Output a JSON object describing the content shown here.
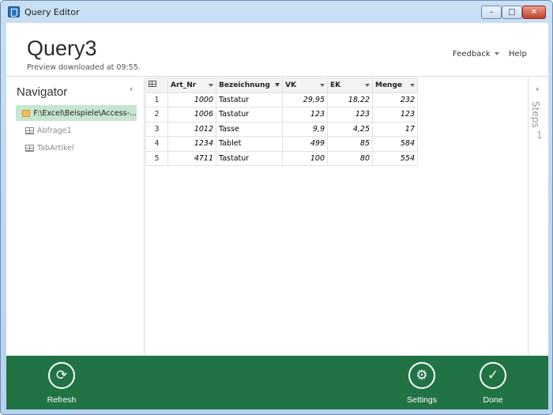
{
  "window": {
    "title": "Query Editor",
    "minimize_glyph": "–",
    "maximize_glyph": "□",
    "close_glyph": "✕"
  },
  "header": {
    "query_title": "Query3",
    "preview_text": "Preview downloaded at 09:55.",
    "feedback_label": "Feedback",
    "help_label": "Help"
  },
  "navigator": {
    "title": "Navigator",
    "collapse_glyph": "‹",
    "items": [
      {
        "label": "F:\\Excel\\Beispiele\\Access-...",
        "icon": "folder-icon",
        "selected": true
      },
      {
        "label": "Abfrage1",
        "icon": "table-icon",
        "selected": false
      },
      {
        "label": "TabArtikel",
        "icon": "table-icon",
        "selected": false
      }
    ]
  },
  "grid": {
    "columns": [
      "Art_Nr",
      "Bezeichnung",
      "VK",
      "EK",
      "Menge"
    ],
    "rows": [
      {
        "idx": "1",
        "Art_Nr": "1000",
        "Bezeichnung": "Tastatur",
        "VK": "29,95",
        "EK": "18,22",
        "Menge": "232"
      },
      {
        "idx": "2",
        "Art_Nr": "1006",
        "Bezeichnung": "Tastatur",
        "VK": "123",
        "EK": "123",
        "Menge": "123"
      },
      {
        "idx": "3",
        "Art_Nr": "1012",
        "Bezeichnung": "Tasse",
        "VK": "9,9",
        "EK": "4,25",
        "Menge": "17"
      },
      {
        "idx": "4",
        "Art_Nr": "1234",
        "Bezeichnung": "Tablet",
        "VK": "499",
        "EK": "85",
        "Menge": "584"
      },
      {
        "idx": "5",
        "Art_Nr": "4711",
        "Bezeichnung": "Tastatur",
        "VK": "100",
        "EK": "80",
        "Menge": "554"
      }
    ]
  },
  "steps": {
    "collapse_glyph": "‹",
    "label": "Steps",
    "count": "1"
  },
  "footer": {
    "refresh_label": "Refresh",
    "refresh_glyph": "⟳",
    "settings_label": "Settings",
    "settings_glyph": "⚙",
    "done_label": "Done",
    "done_glyph": "✓"
  },
  "colors": {
    "accent": "#217346",
    "selection": "#c6e6cf",
    "steps_count": "#7cb890"
  }
}
